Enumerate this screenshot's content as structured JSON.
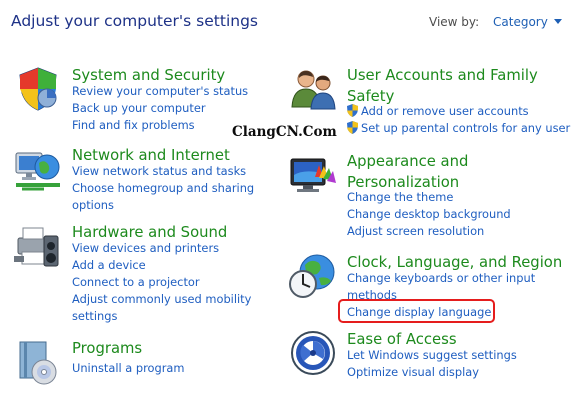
{
  "header": {
    "title": "Adjust your computer's settings"
  },
  "view_by": {
    "label": "View by:",
    "value": "Category"
  },
  "watermark": "ClangCN.Com",
  "categories": {
    "system": {
      "title": "System and Security",
      "links": [
        "Review your computer's status",
        "Back up your computer",
        "Find and fix problems"
      ]
    },
    "network": {
      "title": "Network and Internet",
      "links": [
        "View network status and tasks",
        "Choose homegroup and sharing",
        "options"
      ]
    },
    "hardware": {
      "title": "Hardware and Sound",
      "links": [
        "View devices and printers",
        "Add a device",
        "Connect to a projector",
        "Adjust commonly used mobility",
        "settings"
      ]
    },
    "programs": {
      "title": "Programs",
      "links": [
        "Uninstall a program"
      ]
    },
    "user_accounts": {
      "title_line1": "User Accounts and Family",
      "title_line2": "Safety",
      "links": [
        "Add or remove user accounts",
        "Set up parental controls for any user"
      ]
    },
    "appearance": {
      "title_line1": "Appearance and",
      "title_line2": "Personalization",
      "links": [
        "Change the theme",
        "Change desktop background",
        "Adjust screen resolution"
      ]
    },
    "clock": {
      "title": "Clock, Language, and Region",
      "links": [
        "Change keyboards or other input",
        "methods",
        "Change display language"
      ]
    },
    "ease": {
      "title": "Ease of Access",
      "links": [
        "Let Windows suggest settings",
        "Optimize visual display"
      ]
    }
  },
  "colors": {
    "header": "#1e3287",
    "category_title": "#1d8a1d",
    "link": "#1f5ec0",
    "highlight": "#e51d1d"
  }
}
